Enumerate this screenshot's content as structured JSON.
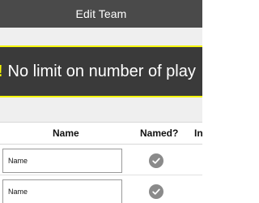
{
  "header": {
    "title": "Edit Team"
  },
  "banner": {
    "new_label": "W!",
    "text": "No limit on number of play"
  },
  "table": {
    "columns": [
      "Name",
      "Named?",
      "In"
    ],
    "rows": [
      {
        "name_value": "Name",
        "named_icon": "checkmark-icon"
      },
      {
        "name_value": "Name",
        "named_icon": "checkmark-icon"
      }
    ]
  },
  "colors": {
    "titlebar": "#4a4a4a",
    "banner_bg": "#3a3a3a",
    "banner_accent": "#f5f500",
    "check_bg": "#8a8a8a"
  }
}
